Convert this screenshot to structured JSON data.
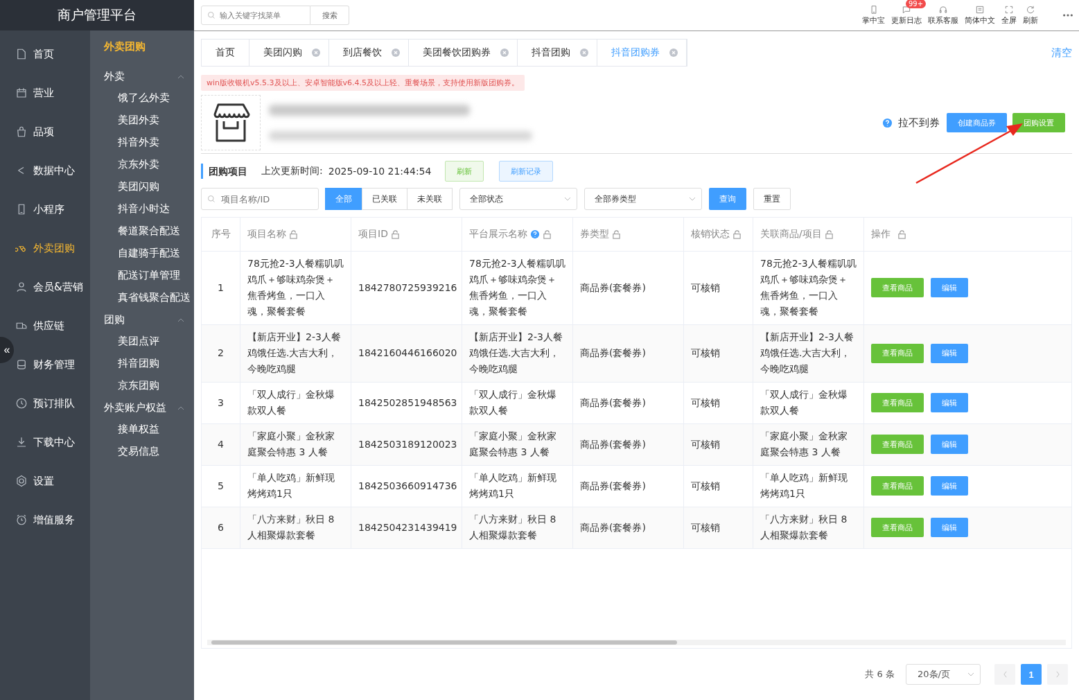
{
  "header": {
    "title": "商户管理平台",
    "search": {
      "placeholder": "输入关键字找菜单",
      "button": "搜索"
    },
    "tools": [
      {
        "label": "掌中宝"
      },
      {
        "label": "更新日志",
        "badge": "99+"
      },
      {
        "label": "联系客服"
      },
      {
        "label": "简体中文"
      },
      {
        "label": "全屏"
      },
      {
        "label": "刷新"
      }
    ]
  },
  "nav": {
    "collapse": "«",
    "items": [
      {
        "label": "首页",
        "selected": false
      },
      {
        "label": "营业",
        "selected": false
      },
      {
        "label": "品项",
        "selected": false
      },
      {
        "label": "数据中心",
        "selected": false
      },
      {
        "label": "小程序",
        "selected": false
      },
      {
        "label": "外卖团购",
        "selected": true
      },
      {
        "label": "会员&营销",
        "selected": false
      },
      {
        "label": "供应链",
        "selected": false
      },
      {
        "label": "财务管理",
        "selected": false
      },
      {
        "label": "预订排队",
        "selected": false
      },
      {
        "label": "下载中心",
        "selected": false
      },
      {
        "label": "设置",
        "selected": false
      },
      {
        "label": "增值服务",
        "selected": false
      }
    ]
  },
  "submenu": {
    "title": "外卖团购",
    "groups": [
      {
        "label": "外卖",
        "expanded": true,
        "children": [
          {
            "label": "饿了么外卖"
          },
          {
            "label": "美团外卖"
          },
          {
            "label": "抖音外卖"
          },
          {
            "label": "京东外卖"
          },
          {
            "label": "美团闪购"
          },
          {
            "label": "抖音小时达"
          },
          {
            "label": "餐道聚合配送"
          },
          {
            "label": "自建骑手配送"
          },
          {
            "label": "配送订单管理"
          },
          {
            "label": "真省钱聚合配送"
          }
        ]
      },
      {
        "label": "团购",
        "expanded": true,
        "children": [
          {
            "label": "美团点评"
          },
          {
            "label": "抖音团购"
          },
          {
            "label": "京东团购"
          }
        ]
      },
      {
        "label": "外卖账户权益",
        "expanded": true,
        "children": [
          {
            "label": "接单权益"
          },
          {
            "label": "交易信息"
          }
        ]
      }
    ]
  },
  "tabs": [
    {
      "label": "首页",
      "closable": false,
      "selected": false
    },
    {
      "label": "美团闪购",
      "closable": true,
      "selected": false
    },
    {
      "label": "到店餐饮",
      "closable": true,
      "selected": false
    },
    {
      "label": "美团餐饮团购券",
      "closable": true,
      "selected": false
    },
    {
      "label": "抖音团购",
      "closable": true,
      "selected": false
    },
    {
      "label": "抖音团购券",
      "closable": true,
      "selected": true
    }
  ],
  "clear_tabs": "清空",
  "notice": "win版收银机v5.5.3及以上、安卓智能版v6.4.5及以上轻、重餐场景，支持使用新版团购券。",
  "store_actions": {
    "help_link": "拉不到券",
    "create_button": "创建商品券",
    "settings_button": "团购设置"
  },
  "section": {
    "title": "团购项目",
    "updated_label": "上次更新时间:",
    "updated_time": "2025-09-10 21:44:54",
    "refresh": "刷新",
    "history": "刷新记录"
  },
  "filters": {
    "search_placeholder": "项目名称/ID",
    "segments": [
      {
        "label": "全部",
        "selected": true
      },
      {
        "label": "已关联",
        "selected": false
      },
      {
        "label": "未关联",
        "selected": false
      }
    ],
    "status_select": "全部状态",
    "type_select": "全部券类型",
    "query": "查询",
    "reset": "重置"
  },
  "table": {
    "columns": [
      {
        "label": "序号",
        "locked": false,
        "help": false
      },
      {
        "label": "项目名称",
        "locked": true,
        "help": false
      },
      {
        "label": "项目ID",
        "locked": true,
        "help": false
      },
      {
        "label": "平台展示名称",
        "locked": true,
        "help": true
      },
      {
        "label": "券类型",
        "locked": true,
        "help": false
      },
      {
        "label": "核销状态",
        "locked": true,
        "help": false
      },
      {
        "label": "关联商品/项目",
        "locked": true,
        "help": false
      },
      {
        "label": "操作",
        "locked": true,
        "help": false
      }
    ],
    "rows": [
      {
        "index": "1",
        "name": "78元抢2-3人餐糯叽叽鸡爪＋够味鸡杂煲＋焦香烤鱼，一口入魂，聚餐套餐",
        "id": "1842780725939216",
        "display_name": "78元抢2-3人餐糯叽叽鸡爪＋够味鸡杂煲＋焦香烤鱼，一口入魂，聚餐套餐",
        "type": "商品券(套餐券)",
        "status": "可核销",
        "linked": "78元抢2-3人餐糯叽叽鸡爪＋够味鸡杂煲＋焦香烤鱼，一口入魂，聚餐套餐",
        "actions": [
          "查看商品",
          "编辑"
        ]
      },
      {
        "index": "2",
        "name": "【新店开业】2-3人餐鸡饿任选.大吉大利，今晚吃鸡腿",
        "id": "1842160446166020",
        "display_name": "【新店开业】2-3人餐鸡饿任选.大吉大利，今晚吃鸡腿",
        "type": "商品券(套餐券)",
        "status": "可核销",
        "linked": "【新店开业】2-3人餐鸡饿任选.大吉大利，今晚吃鸡腿",
        "actions": [
          "查看商品",
          "编辑"
        ]
      },
      {
        "index": "3",
        "name": "「双人成行」金秋爆款双人餐",
        "id": "1842502851948563",
        "display_name": "「双人成行」金秋爆款双人餐",
        "type": "商品券(套餐券)",
        "status": "可核销",
        "linked": "「双人成行」金秋爆款双人餐",
        "actions": [
          "查看商品",
          "编辑"
        ]
      },
      {
        "index": "4",
        "name": "「家庭小聚」金秋家庭聚会特惠 3 人餐",
        "id": "1842503189120023",
        "display_name": "「家庭小聚」金秋家庭聚会特惠 3 人餐",
        "type": "商品券(套餐券)",
        "status": "可核销",
        "linked": "「家庭小聚」金秋家庭聚会特惠 3 人餐",
        "actions": [
          "查看商品",
          "编辑"
        ]
      },
      {
        "index": "5",
        "name": "「单人吃鸡」新鲜现烤烤鸡1只",
        "id": "1842503660914736",
        "display_name": "「单人吃鸡」新鲜现烤烤鸡1只",
        "type": "商品券(套餐券)",
        "status": "可核销",
        "linked": "「单人吃鸡」新鲜现烤烤鸡1只",
        "actions": [
          "查看商品",
          "编辑"
        ]
      },
      {
        "index": "6",
        "name": "「八方来财」秋日 8 人相聚爆款套餐",
        "id": "1842504231439419",
        "display_name": "「八方来财」秋日 8 人相聚爆款套餐",
        "type": "商品券(套餐券)",
        "status": "可核销",
        "linked": "「八方来财」秋日 8 人相聚爆款套餐",
        "actions": [
          "查看商品",
          "编辑"
        ]
      }
    ]
  },
  "pagination": {
    "total": "共 6 条",
    "page_size": "20条/页",
    "pages": [
      {
        "label": "1",
        "selected": true
      }
    ]
  }
}
